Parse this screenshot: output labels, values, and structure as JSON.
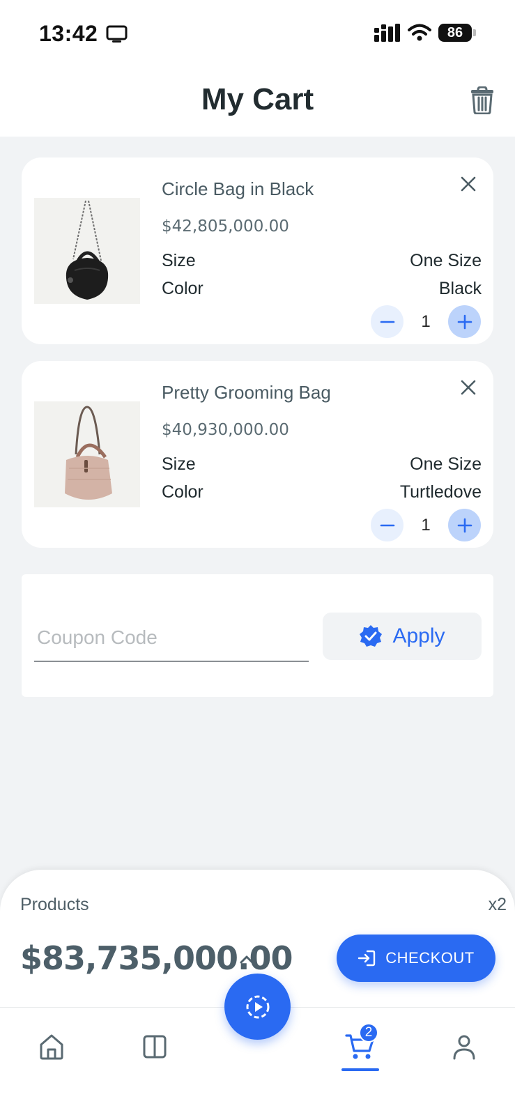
{
  "status_bar": {
    "time": "13:42",
    "battery": "86"
  },
  "header": {
    "title": "My Cart"
  },
  "cart_items": [
    {
      "name": "Circle Bag in Black",
      "price": "$42,805,000.00",
      "size_label": "Size",
      "size": "One Size",
      "color_label": "Color",
      "color": "Black",
      "quantity": "1"
    },
    {
      "name": "Pretty Grooming Bag",
      "price": "$40,930,000.00",
      "size_label": "Size",
      "size": "One Size",
      "color_label": "Color",
      "color": "Turtledove",
      "quantity": "1"
    }
  ],
  "coupon": {
    "placeholder": "Coupon Code",
    "value": "",
    "apply_label": "Apply"
  },
  "summary": {
    "products_label": "Products",
    "count": "x2",
    "total": "$83,735,000.00",
    "checkout_label": "CHECKOUT"
  },
  "bottom_nav": {
    "cart_badge": "2",
    "active": "cart"
  },
  "colors": {
    "accent": "#2a6af2",
    "background": "#f1f3f5",
    "text": "#1f2a2e"
  }
}
